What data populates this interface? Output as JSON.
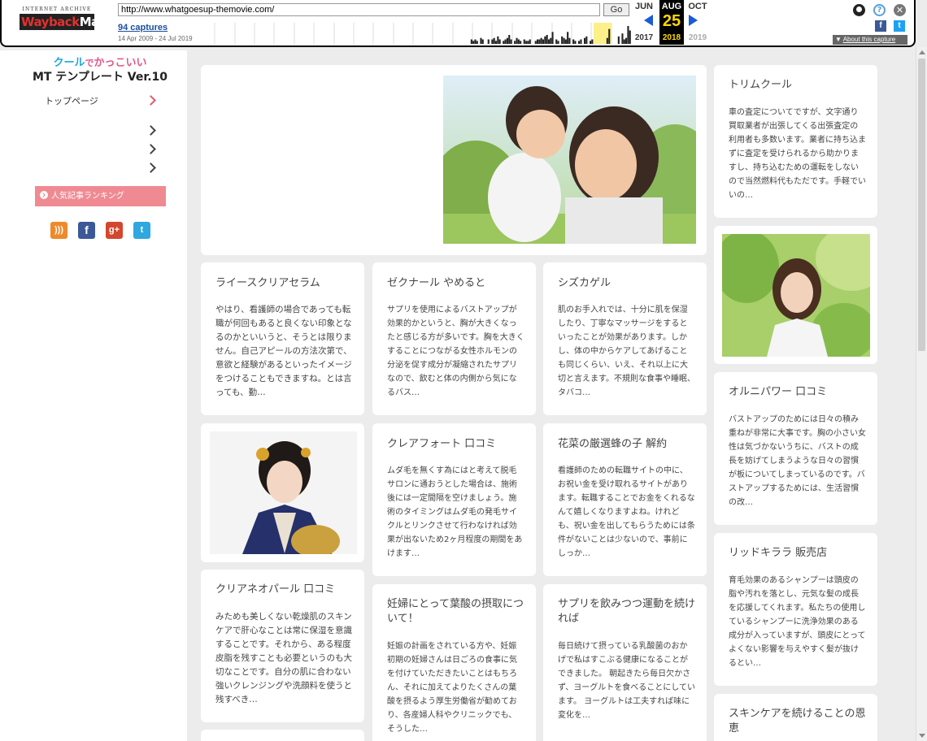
{
  "wayback": {
    "logo_top": "INTERNET ARCHIVE",
    "logo_main_1": "Wayback",
    "logo_main_2": "Machine",
    "url": "http://www.whatgoesup-themovie.com/",
    "go_label": "Go",
    "captures": "94 captures",
    "range": "14 Apr 2009 - 24 Jul 2019",
    "months": {
      "prev": "JUN",
      "cur": "AUG",
      "next": "OCT"
    },
    "day": "25",
    "years": {
      "prev": "2017",
      "cur": "2018",
      "next": "2019"
    },
    "about": "About this capture",
    "icons": [
      "user-icon",
      "help-icon",
      "close-icon",
      "facebook-icon",
      "twitter-icon"
    ],
    "sparkline": [
      0,
      0,
      0,
      0,
      0,
      0,
      0,
      0,
      0,
      0,
      0,
      0,
      0,
      0,
      0,
      0,
      0,
      0,
      0,
      0,
      0,
      0,
      0,
      0,
      0,
      0,
      0,
      0,
      0,
      0,
      0,
      0,
      0,
      0,
      0,
      0,
      0,
      0,
      0,
      0,
      0,
      0,
      0,
      0,
      0,
      0,
      0,
      0,
      0,
      0,
      0,
      0,
      0,
      0,
      0,
      0,
      0,
      0,
      0,
      0,
      0,
      0,
      0,
      0,
      0,
      0,
      0,
      0,
      0,
      0,
      0,
      0,
      0,
      0,
      0,
      0,
      0,
      0,
      0,
      0,
      0,
      0,
      0,
      0,
      0,
      0,
      0,
      0,
      0,
      0,
      0,
      0,
      0,
      0,
      0,
      0,
      0,
      0,
      0,
      0,
      0,
      0,
      0,
      0,
      0,
      0,
      0,
      0,
      0,
      0,
      0,
      0,
      0,
      0,
      0,
      0,
      0,
      0,
      0,
      0,
      0,
      0,
      0,
      0,
      0,
      0,
      0,
      0,
      0,
      0,
      0,
      0,
      0,
      0,
      0,
      0,
      0,
      0,
      0,
      0,
      0,
      0,
      0,
      0,
      0,
      0,
      3,
      2,
      3,
      2,
      0,
      4,
      3,
      0,
      0,
      3,
      0,
      3,
      4,
      2,
      5,
      3,
      0,
      2,
      3,
      4,
      6,
      3,
      0,
      2,
      4,
      3,
      2,
      0,
      3,
      2,
      2,
      3,
      0,
      0,
      2,
      3,
      3,
      4,
      3,
      5,
      6,
      3,
      4,
      8,
      0,
      3,
      2,
      0,
      5,
      4,
      3,
      8,
      4,
      0,
      3,
      2,
      0,
      2,
      3,
      0,
      4,
      5,
      0,
      2,
      3,
      0,
      0,
      0,
      0,
      0,
      0,
      0,
      4,
      10,
      0,
      0,
      0,
      0,
      5,
      0,
      7,
      3,
      4,
      12,
      9
    ]
  },
  "sidebar": {
    "logo_line1_a": "クール",
    "logo_line1_b": "で",
    "logo_line1_c": "かっこいい",
    "logo_line2": "MT テンプレート Ver.10",
    "home_label": "トップページ",
    "ranking_label": "人気記事ランキング",
    "social": [
      "rss-icon",
      "facebook-icon",
      "google-plus-icon",
      "twitter-icon"
    ]
  },
  "cards": {
    "c1": {
      "title": "ライースクリアセラム",
      "body": "やはり、看護師の場合であっても転職が何回もあると良くない印象となるのかといいうと、そうとは限りません。自己アピールの方法次第で、意欲と経験があるといったイメージをつけることもできますね。とは言っても、勤…"
    },
    "c2": {
      "title": "ゼクナール やめると",
      "body": "サプリを使用によるバストアップが効果的かというと、胸が大きくなったと感じる方が多いです。胸を大きくすることにつながる女性ホルモンの分泌を促す成分が凝縮されたサプリなので、飲むと体の内側から気になるバス…"
    },
    "c3": {
      "title": "シズカゲル",
      "body": "肌のお手入れでは、十分に肌を保湿したり、丁寧なマッサージをするといったことが効果があります。しかし、体の中からケアしてあげることも同じくらい、いえ、それ以上に大切と言えます。不規則な食事や睡眠、タバコ…"
    },
    "c4": {
      "title": "クレアフォート 口コミ",
      "body": "ムダ毛を無くす為にはと考えて脱毛サロンに通おうとした場合は、施術後には一定間隔を空けましょう。施術のタイミングはムダ毛の発毛サイクルとリンクさせて行わなければ効果が出ないため2ヶ月程度の期間をあけます…"
    },
    "c5": {
      "title": "花菜の厳選蜂の子 解約",
      "body": "看護師のための転職サイトの中に、お祝い金を受け取れるサイトがあります。転職することでお金をくれるなんて嬉しくなりますよね。けれども、祝い金を出してもらうためには条件がないことは少ないので、事前にしっか…"
    },
    "c6": {
      "title": "クリアネオパール 口コミ",
      "body": "みためも美しくない乾燥肌のスキンケアで肝心なことは常に保湿を意識することです。それから、ある程度皮脂を残すことも必要というのも大切なことです。自分の肌に合わない強いクレンジングや洗顔料を使うと残すべき…"
    },
    "c7": {
      "title": "妊婦にとって葉酸の摂取について！",
      "body": "妊娠の計画をされている方や、妊娠初期の妊婦さんは日ごろの食事に気を付けていただきたいことはもちろん、それに加えてよりたくさんの葉酸を摂るよう厚生労働省が勧めており、各産婦人科やクリニックでも、そうした…"
    },
    "c8": {
      "title": "サプリを飲みつつ運動を続ければ",
      "body": "毎日続けて摂っている乳酸菌のおかげで私はすこぶる健康になることができました。 朝起きたら毎日欠かさず、ヨーグルトを食べることにしています。 ヨーグルトは工夫すれば味に変化を…"
    },
    "r1": {
      "title": "トリムクール",
      "body": "車の査定についてですが、文字通り買取業者が出張してくる出張査定の利用者も多数います。業者に持ち込まずに査定を受けられるから助かりますし、持ち込むための運転をしないので当然燃料代もただです。手軽でいいの…"
    },
    "r2": {
      "title": "オルニパワー 口コミ",
      "body": "バストアップのためには日々の積み重ねが非常に大事です。胸の小さい女性は気づかないうちに、バストの成長を妨げてしまうような日々の習慣が板についてしまっているのです。バストアップするためには、生活習慣の改…"
    },
    "r3": {
      "title": "リッドキララ 販売店",
      "body": "育毛効果のあるシャンプーは頭皮の脂や汚れを落とし、元気な髪の成長を応援してくれます。私たちの使用しているシャンプーに洗浄効果のある成分が入っていますが、頭皮にとってよくない影響を与えやすく髪が抜けるとい…"
    },
    "r4": {
      "title": "スキンケアを続けることの恩恵"
    }
  },
  "colors": {
    "accent_pink": "#f08a92",
    "accent_blue": "#1ba6e0"
  }
}
